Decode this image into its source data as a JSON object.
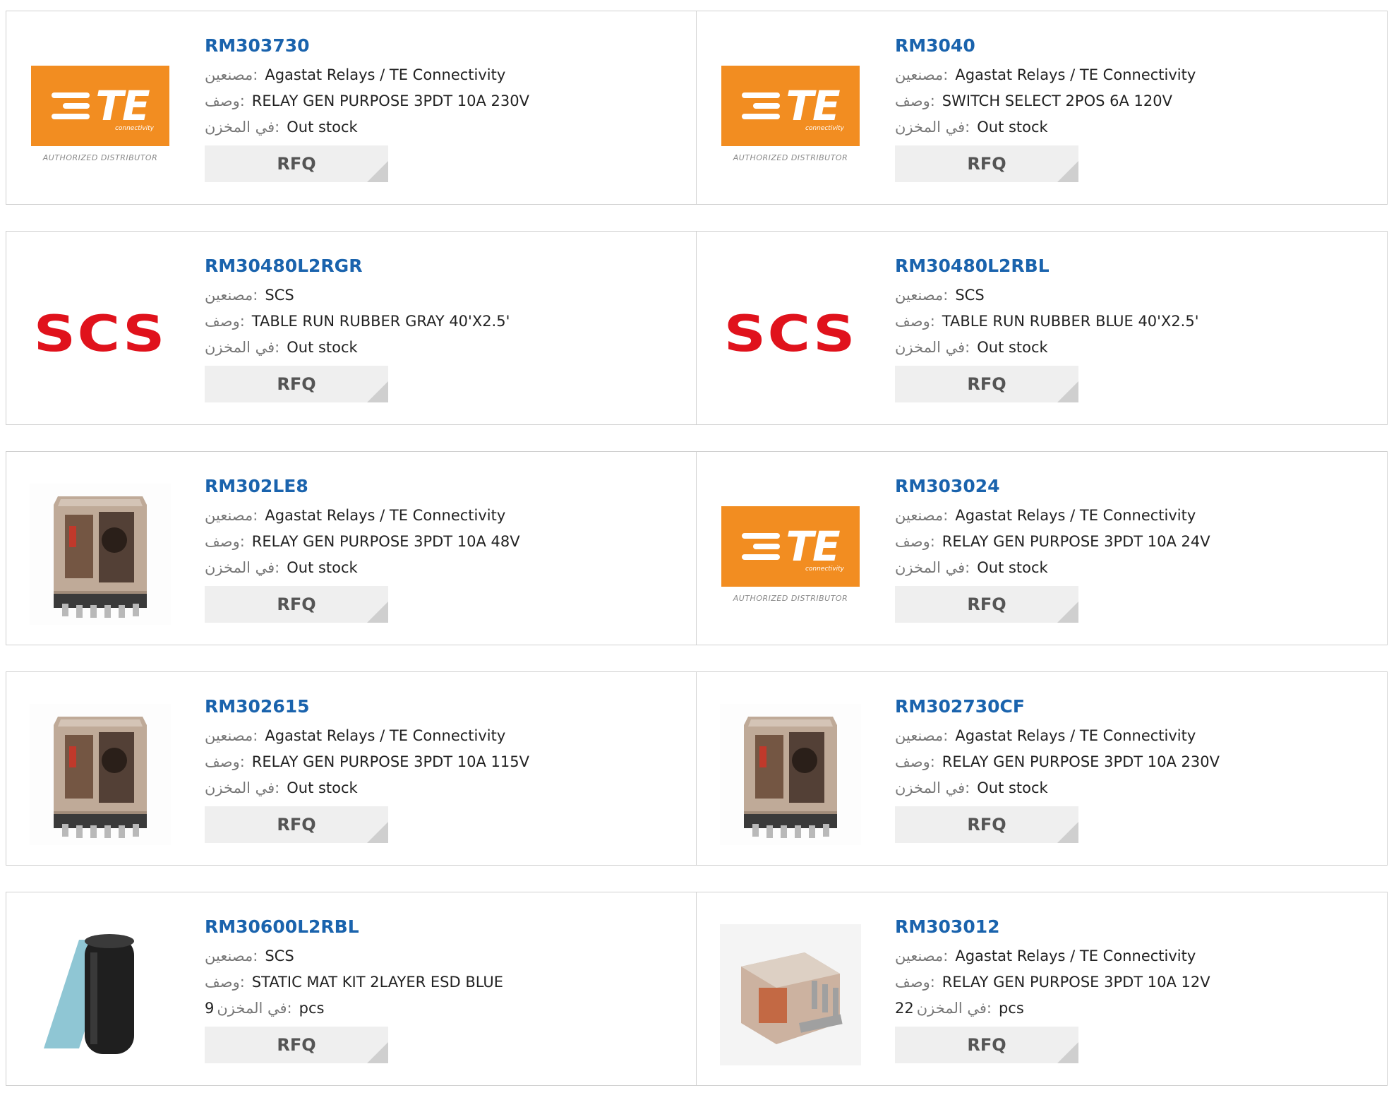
{
  "labels": {
    "manufacturer": "مصنعين:",
    "description": "وصف:",
    "in_stock": "في المخزن:",
    "rfq": "RFQ"
  },
  "colors": {
    "link": "#1a63ad",
    "te_orange": "#f28d21",
    "scs_red": "#e0121c"
  },
  "products": [
    {
      "part": "RM303730",
      "image": "te-logo",
      "manufacturer": "Agastat Relays / TE Connectivity",
      "description": "RELAY GEN PURPOSE 3PDT 10A 230V",
      "stock": "Out stock"
    },
    {
      "part": "RM3040",
      "image": "te-logo",
      "manufacturer": "Agastat Relays / TE Connectivity",
      "description": "SWITCH SELECT 2POS 6A 120V",
      "stock": "Out stock"
    },
    {
      "part": "RM30480L2RGR",
      "image": "scs-logo",
      "manufacturer": "SCS",
      "description": "TABLE RUN RUBBER GRAY 40'X2.5'",
      "stock": "Out stock"
    },
    {
      "part": "RM30480L2RBL",
      "image": "scs-logo",
      "manufacturer": "SCS",
      "description": "TABLE RUN RUBBER BLUE 40'X2.5'",
      "stock": "Out stock"
    },
    {
      "part": "RM302LE8",
      "image": "relay-photo",
      "manufacturer": "Agastat Relays / TE Connectivity",
      "description": "RELAY GEN PURPOSE 3PDT 10A 48V",
      "stock": "Out stock"
    },
    {
      "part": "RM303024",
      "image": "te-logo",
      "manufacturer": "Agastat Relays / TE Connectivity",
      "description": "RELAY GEN PURPOSE 3PDT 10A 24V",
      "stock": "Out stock"
    },
    {
      "part": "RM302615",
      "image": "relay-photo",
      "manufacturer": "Agastat Relays / TE Connectivity",
      "description": "RELAY GEN PURPOSE 3PDT 10A 115V",
      "stock": "Out stock"
    },
    {
      "part": "RM302730CF",
      "image": "relay-photo",
      "manufacturer": "Agastat Relays / TE Connectivity",
      "description": "RELAY GEN PURPOSE 3PDT 10A 230V",
      "stock": "Out stock"
    },
    {
      "part": "RM30600L2RBL",
      "image": "mat-roll-photo",
      "manufacturer": "SCS",
      "description": "STATIC MAT KIT 2LAYER ESD BLUE",
      "stock_qty": "9",
      "stock_unit": "pcs"
    },
    {
      "part": "RM303012",
      "image": "relay-side-photo",
      "manufacturer": "Agastat Relays / TE Connectivity",
      "description": "RELAY GEN PURPOSE 3PDT 10A 12V",
      "stock_qty": "22",
      "stock_unit": "pcs"
    }
  ],
  "logos": {
    "te_text": "TE",
    "te_sub": "connectivity",
    "te_auth": "AUTHORIZED DISTRIBUTOR",
    "scs_text": "SCS"
  }
}
